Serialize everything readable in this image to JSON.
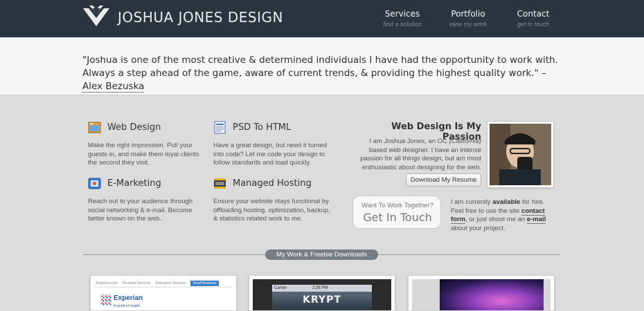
{
  "header": {
    "logo_text": "JOSHUA JONES DESIGN",
    "bg_color": "#2b3540",
    "nav": [
      {
        "label": "Services",
        "sub": "find a solution"
      },
      {
        "label": "Portfolio",
        "sub": "view my work"
      },
      {
        "label": "Contact",
        "sub": "get in touch"
      }
    ]
  },
  "quote": {
    "text": "\"Joshua is one of the most creative & determined individuals I have had the opportunity to work with. Always a step ahead of the game, aware of current trends, & providing the highest quality work.\" – ",
    "author": "Alex Bezuska"
  },
  "services": [
    {
      "title": "Web Design",
      "icon": "web-design-icon",
      "desc": "Make the right impression. Pull your guests in, and make them loyal clients the second they visit."
    },
    {
      "title": "PSD To HTML",
      "icon": "psd-to-html-icon",
      "desc": "Have a great design, but need it turned into code? Let me code your design to follow standards and load quickly."
    },
    {
      "title": "E-Marketing",
      "icon": "e-marketing-icon",
      "desc": "Reach out to your audience through social networking & e-mail. Become better known on the web."
    },
    {
      "title": "Managed Hosting",
      "icon": "managed-hosting-icon",
      "desc": "Ensure your website stays functional by offloading hosting, optimization, backup, & statistics related work to me."
    }
  ],
  "passion": {
    "title": "Web Design Is My Passion",
    "text_a": "I am Joshua Jones, an OC ",
    "text_italic": "(California)",
    "text_b": " based web designer. I have an intense passion for all things design, but am most enthusiastic about designing for the web.",
    "resume_button": "Download My Resume"
  },
  "contact": {
    "small": "Want To Work Together?",
    "big": "Get In Touch",
    "hire_a": "I am currently ",
    "hire_bold": "available",
    "hire_b": " for hire. Feel free to use the site ",
    "contact_link": "contact form",
    "hire_c": ", or just shoot me an ",
    "email_link": "e-mail",
    "hire_d": " about your project."
  },
  "divider": {
    "label": "My Work & Freebie Downloads"
  },
  "portfolio": {
    "thumb1": {
      "nav": [
        "Experian.com",
        "Personal Services",
        "Enterprise Services",
        "Small Business"
      ],
      "logo": "Experian",
      "tagline": "A world of insight"
    },
    "thumb2": {
      "carrier": "Carrier",
      "time": "2:26 PM",
      "title": "KRYPT"
    }
  }
}
